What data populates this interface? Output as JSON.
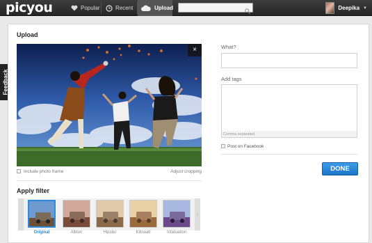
{
  "app": {
    "logo": "picyou"
  },
  "nav": {
    "popular": "Popular",
    "recent": "Recent",
    "upload": "Upload"
  },
  "search": {
    "placeholder": ""
  },
  "user": {
    "name": "Deepika"
  },
  "feedback": {
    "label": "Feedback"
  },
  "upload": {
    "title": "Upload",
    "close": "×",
    "include_frame": "Include photo frame",
    "adjust_cropping": "Adjust cropping"
  },
  "filters": {
    "title": "Apply filter",
    "items": [
      {
        "label": "Original"
      },
      {
        "label": "Albion"
      },
      {
        "label": "Hipster"
      },
      {
        "label": "Kilowatt"
      },
      {
        "label": "Infatuation"
      }
    ],
    "selected": "Original"
  },
  "form": {
    "what_label": "What?",
    "what_value": "",
    "tags_label": "Add tags",
    "tags_value": "",
    "tags_hint": "Comma separated",
    "facebook_label": "Post on Facebook",
    "done": "DONE"
  },
  "colors": {
    "accent": "#2a8ae0",
    "topbar": "#2e2e2e",
    "done": "#1c74c9"
  },
  "icons": [
    "heart-icon",
    "clock-icon",
    "cloud-icon",
    "search-icon",
    "chevron-down-icon",
    "close-icon"
  ]
}
